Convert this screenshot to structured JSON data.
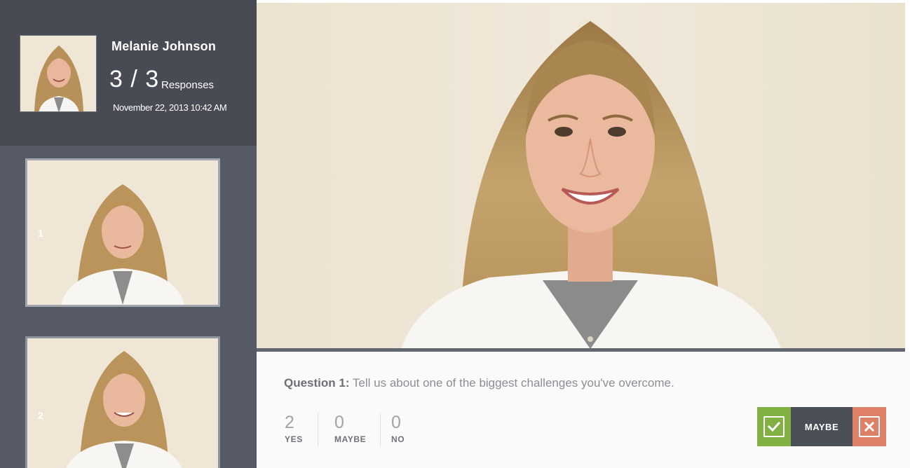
{
  "candidate": {
    "name": "Melanie Johnson",
    "responses_count": "3 / 3",
    "responses_label": "Responses",
    "timestamp": "November 22, 2013 10:42 AM"
  },
  "thumbnails": [
    {
      "number": "1"
    },
    {
      "number": "2"
    }
  ],
  "question": {
    "label": "Question 1:",
    "text": " Tell us about one of the biggest challenges you've overcome."
  },
  "tallies": {
    "yes": {
      "count": "2",
      "label": "YES"
    },
    "maybe": {
      "count": "0",
      "label": "MAYBE"
    },
    "no": {
      "count": "0",
      "label": "NO"
    }
  },
  "actions": {
    "yes_icon": "check-icon",
    "maybe_label": "MAYBE",
    "no_icon": "close-icon"
  },
  "colors": {
    "sidebar": "#565a64",
    "profile_card": "#484b53",
    "yes_green": "#83b042",
    "maybe_dark": "#4b4f58",
    "no_salmon": "#de8067"
  }
}
